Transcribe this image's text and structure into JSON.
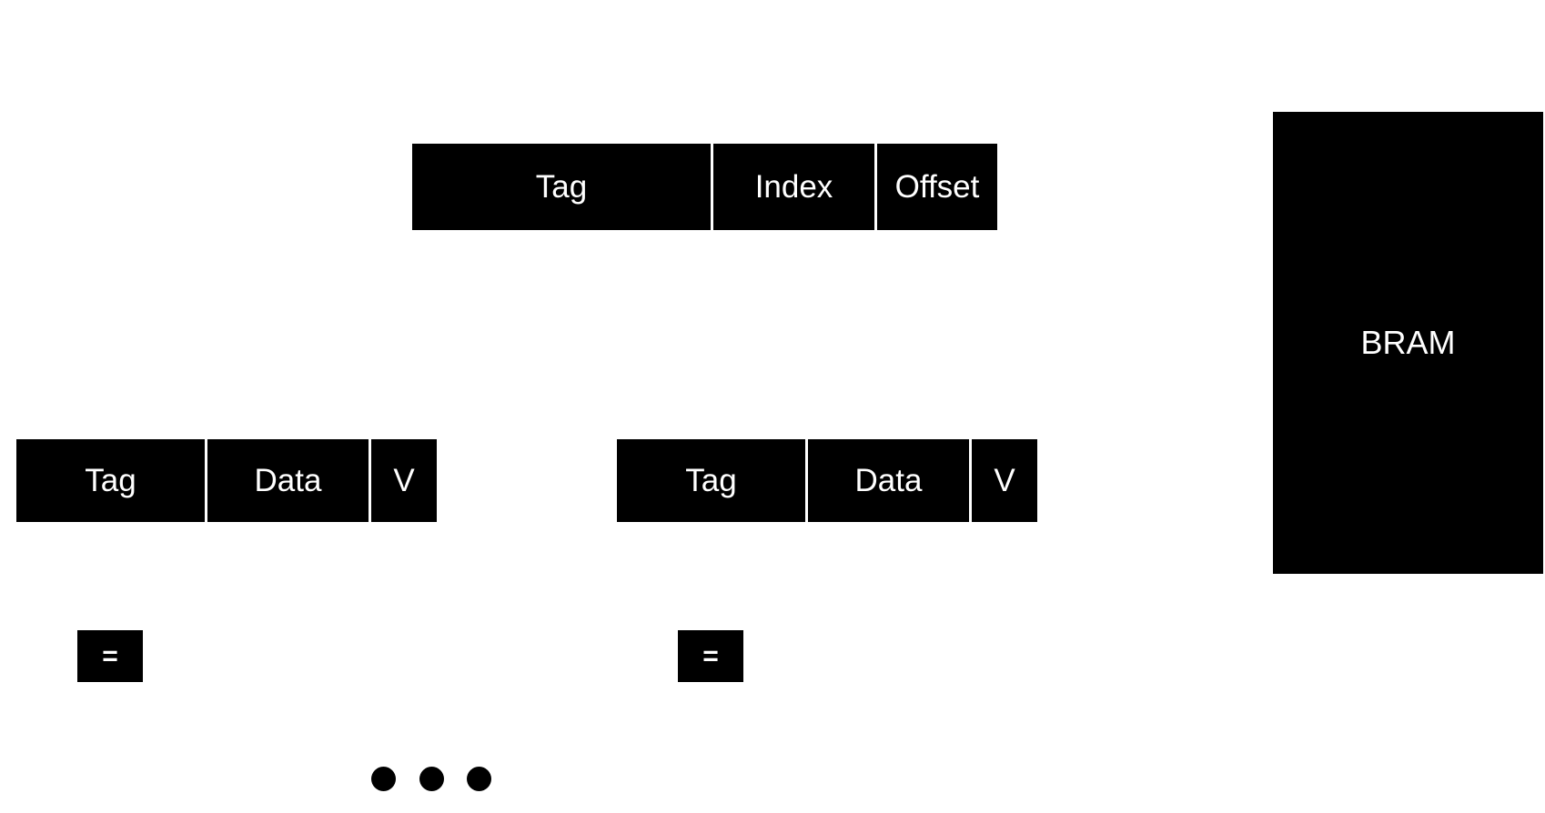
{
  "address": {
    "fields": [
      {
        "label": "Tag"
      },
      {
        "label": "Index"
      },
      {
        "label": "Offset"
      }
    ]
  },
  "cache_lines": [
    {
      "fields": [
        {
          "label": "Tag"
        },
        {
          "label": "Data"
        },
        {
          "label": "V"
        }
      ],
      "comparator": "="
    },
    {
      "fields": [
        {
          "label": "Tag"
        },
        {
          "label": "Data"
        },
        {
          "label": "V"
        }
      ],
      "comparator": "="
    }
  ],
  "bram": {
    "label": "BRAM"
  },
  "ellipsis": {
    "count": 3
  }
}
